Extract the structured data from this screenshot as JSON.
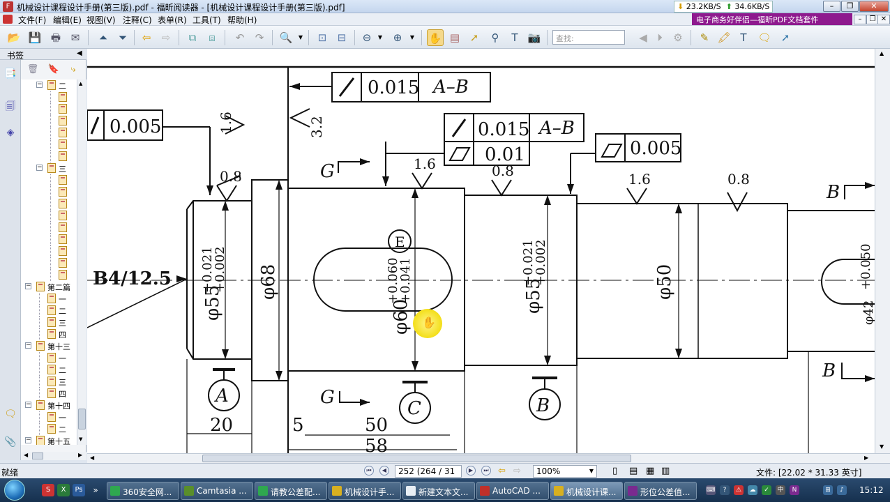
{
  "window": {
    "title": "机械设计课程设计手册(第三版).pdf - 福昕阅读器 - [机械设计课程设计手册(第三版).pdf]",
    "app_icon": "foxit-icon",
    "net_down": "23.2KB/S",
    "net_up": "34.6KB/S",
    "ad_text": "电子商务好伴侣—福昕PDF文档套件",
    "controls": [
      "minimize",
      "restore",
      "close"
    ]
  },
  "menu": {
    "items": [
      "文件(F)",
      "编辑(E)",
      "视图(V)",
      "注释(C)",
      "表单(R)",
      "工具(T)",
      "帮助(H)"
    ]
  },
  "toolbar": {
    "search_placeholder": "查找:"
  },
  "bookmarks": {
    "header": "书签",
    "tree": [
      {
        "label": "二",
        "level": 2,
        "type": "expand"
      },
      {
        "label": "",
        "level": 3
      },
      {
        "label": "",
        "level": 3
      },
      {
        "label": "",
        "level": 3
      },
      {
        "label": "",
        "level": 3
      },
      {
        "label": "",
        "level": 3
      },
      {
        "label": "",
        "level": 3
      },
      {
        "label": "三",
        "level": 2,
        "type": "expand"
      },
      {
        "label": "",
        "level": 3
      },
      {
        "label": "",
        "level": 3
      },
      {
        "label": "",
        "level": 3
      },
      {
        "label": "",
        "level": 3
      },
      {
        "label": "",
        "level": 3
      },
      {
        "label": "",
        "level": 3
      },
      {
        "label": "",
        "level": 3
      },
      {
        "label": "",
        "level": 3
      },
      {
        "label": "",
        "level": 3
      },
      {
        "label": "第二篇",
        "level": 1,
        "type": "expand"
      },
      {
        "label": "一",
        "level": 2
      },
      {
        "label": "二",
        "level": 2
      },
      {
        "label": "三",
        "level": 2
      },
      {
        "label": "四",
        "level": 2
      },
      {
        "label": "第十三",
        "level": 1,
        "type": "expand"
      },
      {
        "label": "一",
        "level": 2
      },
      {
        "label": "二",
        "level": 2
      },
      {
        "label": "三",
        "level": 2
      },
      {
        "label": "四",
        "level": 2
      },
      {
        "label": "第十四",
        "level": 1,
        "type": "expand"
      },
      {
        "label": "一",
        "level": 2
      },
      {
        "label": "二",
        "level": 2
      },
      {
        "label": "第十五",
        "level": 1,
        "type": "expand"
      },
      {
        "label": "一",
        "level": 2
      },
      {
        "label": "二",
        "level": 2
      }
    ]
  },
  "drawing": {
    "labels": {
      "tol1_val": "0.015",
      "tol1_ref": "A–B",
      "tol2_val": "0.005",
      "tol3_val": "0.015",
      "tol3_ref": "A–B",
      "tol4_val": "0.01",
      "tol5_val": "0.005",
      "rough_16a": "1.6",
      "rough_32": "3.2",
      "rough_08a": "0.8",
      "rough_16b": "1.6",
      "rough_08b": "0.8",
      "rough_16c": "1.6",
      "rough_08c": "0.8",
      "center_hole": "B4/12.5",
      "dia55a": "φ55",
      "dia55a_upper": "+0.021",
      "dia55a_lower": "+0.002",
      "dia68": "φ68",
      "dia60": "φ60",
      "dia60_upper": "+0.060",
      "dia60_lower": "+0.041",
      "envelope_E": "E",
      "dia55b": "φ55",
      "dia55b_upper": "+0.021",
      "dia55b_lower": "+0.002",
      "dia50": "φ50",
      "dia42_upper": "+0.050",
      "dia42_fragment": "φ42",
      "datum_A": "A",
      "datum_B": "B",
      "datum_C": "C",
      "section_G": "G",
      "section_B": "B",
      "dim20": "20",
      "dim5": "5",
      "dim50": "50",
      "dim58": "58"
    }
  },
  "status": {
    "left_text": "就绪",
    "page_text": "252 (264 / 31",
    "zoom": "100%",
    "doc_size": "文件: [22.02 * 31.33 英寸]"
  },
  "taskbar": {
    "tasks": [
      {
        "label": "360安全网...",
        "color": "#2fa84f"
      },
      {
        "label": "Camtasia ...",
        "color": "#5a8f2a"
      },
      {
        "label": "请教公差配...",
        "color": "#2fa84f"
      },
      {
        "label": "机械设计手...",
        "color": "#d8b020"
      },
      {
        "label": "新建文本文...",
        "color": "#e8eef4"
      },
      {
        "label": "AutoCAD ...",
        "color": "#c0302a"
      },
      {
        "label": "机械设计课...",
        "color": "#d8b020",
        "active": true
      },
      {
        "label": "形位公差值...",
        "color": "#7a2a8f"
      }
    ],
    "clock": "15:12"
  }
}
